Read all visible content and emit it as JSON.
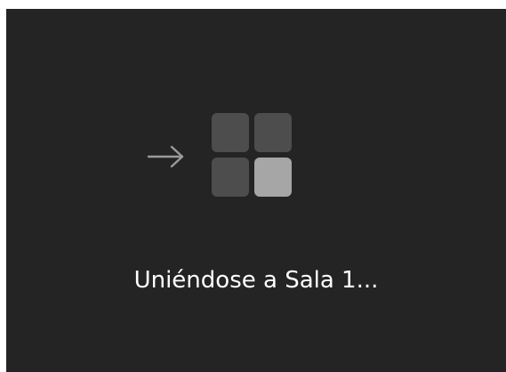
{
  "status": {
    "text": "Uniéndose a Sala 1..."
  },
  "icons": {
    "arrow": "arrow-right-icon",
    "rooms": "breakout-rooms-grid-icon"
  },
  "colors": {
    "background": "#242424",
    "text": "#ffffff",
    "arrow": "#9a9a9a",
    "tile_dim": "#4d4d4d",
    "tile_active": "#a6a6a6"
  }
}
